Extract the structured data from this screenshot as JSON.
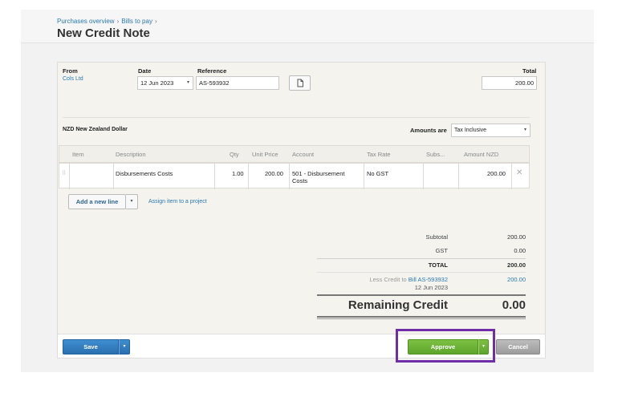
{
  "breadcrumb": {
    "item1": "Purchases overview",
    "item2": "Bills to pay",
    "sep": "›"
  },
  "page_title": "New Credit Note",
  "form": {
    "from_label": "From",
    "from_value": "Cols Ltd",
    "date_label": "Date",
    "date_value": "12 Jun 2023",
    "reference_label": "Reference",
    "reference_value": "AS-593932",
    "total_label": "Total",
    "total_value": "200.00",
    "currency": "NZD New Zealand Dollar",
    "amounts_are_label": "Amounts are",
    "amounts_are_value": "Tax Inclusive",
    "attach_icon": "document-icon"
  },
  "table": {
    "headers": {
      "item": "Item",
      "description": "Description",
      "qty": "Qty",
      "unit_price": "Unit Price",
      "account": "Account",
      "tax_rate": "Tax Rate",
      "subtotal": "Subs...",
      "amount": "Amount NZD"
    },
    "row": {
      "item": "",
      "description": "Disbursements Costs",
      "qty": "1.00",
      "unit_price": "200.00",
      "account_line1": "501 - Disbursement",
      "account_line2": "Costs",
      "tax_rate": "No GST",
      "subtotal": "",
      "amount": "200.00",
      "delete_icon": "close-icon"
    }
  },
  "actions": {
    "add_line": "Add a new line",
    "assign_project": "Assign item to a project"
  },
  "totals": {
    "subtotal_label": "Subtotal",
    "subtotal_value": "200.00",
    "gst_label": "GST",
    "gst_value": "0.00",
    "total_label": "TOTAL",
    "total_value": "200.00",
    "less_credit_prefix": "Less Credit to",
    "less_credit_link": "Bill AS-593932",
    "less_credit_date": "12 Jun 2023",
    "less_credit_value": "200.00",
    "remaining_label": "Remaining Credit",
    "remaining_value": "0.00"
  },
  "footer": {
    "save": "Save",
    "approve": "Approve",
    "cancel": "Cancel",
    "caret": "▾"
  },
  "colors": {
    "link": "#2a7ab0",
    "save": "#2a6fb0",
    "approve": "#5ea52c",
    "cancel": "#9c9c9c",
    "highlight": "#6f2da8"
  }
}
